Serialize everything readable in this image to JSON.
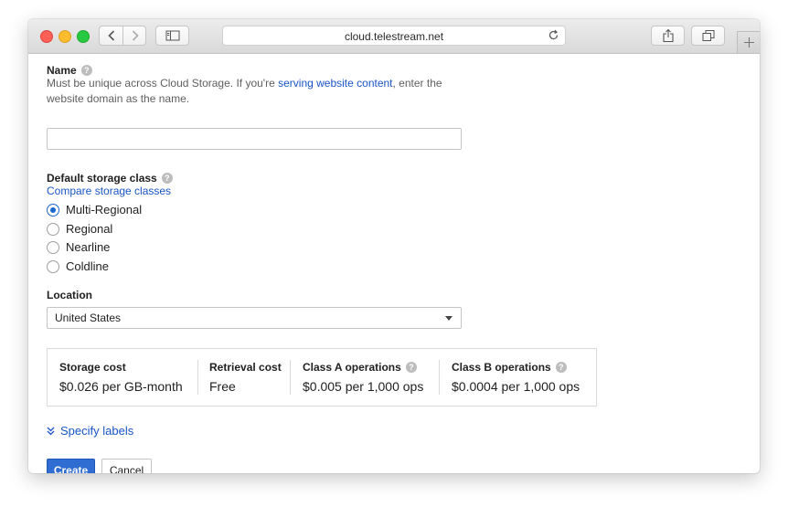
{
  "browser": {
    "url": "cloud.telestream.net",
    "icons": [
      "back-icon",
      "forward-icon",
      "sidebar-icon",
      "reload-icon",
      "share-icon",
      "tabs-icon",
      "new-tab-icon"
    ]
  },
  "form": {
    "name": {
      "label": "Name",
      "desc_before": "Must be unique across Cloud Storage. If you're ",
      "desc_link": "serving website content",
      "desc_after": ", enter the website domain as the name.",
      "value": ""
    },
    "storage_class": {
      "label": "Default storage class",
      "compare_link": "Compare storage classes",
      "options": [
        "Multi-Regional",
        "Regional",
        "Nearline",
        "Coldline"
      ],
      "selected": "Multi-Regional"
    },
    "location": {
      "label": "Location",
      "value": "United States"
    },
    "costs": [
      {
        "label": "Storage cost",
        "value": "$0.026 per GB-month"
      },
      {
        "label": "Retrieval cost",
        "value": "Free"
      },
      {
        "label": "Class A operations",
        "value": "$0.005 per 1,000 ops"
      },
      {
        "label": "Class B operations",
        "value": "$0.0004 per 1,000 ops"
      }
    ],
    "specify_labels": "Specify labels",
    "create_label": "Create",
    "cancel_label": "Cancel"
  },
  "colors": {
    "link": "#1a55c5",
    "primary_button": "#2f6dd3",
    "radio_selected": "#1a66cc"
  }
}
